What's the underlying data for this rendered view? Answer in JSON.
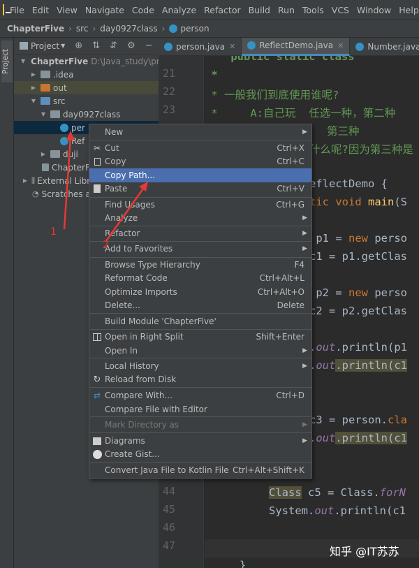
{
  "menubar": {
    "items": [
      "File",
      "Edit",
      "View",
      "Navigate",
      "Code",
      "Analyze",
      "Refactor",
      "Build",
      "Run",
      "Tools",
      "VCS",
      "Window",
      "Help"
    ]
  },
  "breadcrumb": {
    "project": "ChapterFive",
    "src": "src",
    "pkg": "day0927class",
    "cls": "person"
  },
  "sidebar": {
    "tab": "Project"
  },
  "project_panel": {
    "title": "Project"
  },
  "tree": {
    "root_label": "ChapterFive",
    "root_path": "D:\\Java_study\\prc",
    "idea": ".idea",
    "out": "out",
    "src": "src",
    "pkg": "day0927class",
    "person": "per",
    "reflect": "Ref",
    "duji": "duji",
    "iml": "ChapterF",
    "extlib": "External Libr",
    "scratch": "Scratches an"
  },
  "tabs": [
    {
      "label": "person.java"
    },
    {
      "label": "ReflectDemo.java"
    },
    {
      "label": "Number.java"
    }
  ],
  "gutter": {
    "lines": [
      "21",
      "22",
      "23",
      "",
      "",
      "",
      "",
      "",
      "",
      "",
      "",
      "",
      "",
      "",
      "",
      "",
      "",
      "",
      "",
      "",
      "",
      "",
      "",
      "",
      "44",
      "45",
      "46",
      "47"
    ]
  },
  "code": {
    "l20": "    public static class ",
    "l21": " *",
    "l22": " * 一般我们到底使用谁呢?",
    "l23a": " *     A:自己玩  任选一种，第二种",
    "l23b": "第三种",
    "l23c": "什么呢?因为第三种是",
    "l_cls": "eflectDemo {",
    "l_main_kw": "tic void ",
    "l_main_fn": "main",
    "l_main_rest": "(S",
    "l_p1": " p1 = ",
    "l_p1_new": "new",
    "l_p1_rest": " perso",
    "l_c1": "c1 = p1.getClas",
    "l_p2": " p2 = ",
    "l_p2_new": "new",
    "l_p2_rest": " perso",
    "l_c2": "c2 = p2.getClas",
    "l_pr1a": ".",
    "l_pr1b": "out",
    "l_pr1c": ".println(p1",
    "l_pr2a": ".",
    "l_pr2b": "out",
    "l_pr2c": ".println(c1",
    "l_c3": "c3 = person.",
    "l_c3b": "cla",
    "l_pr3a": ".",
    "l_pr3b": "out",
    "l_pr3c": ".println(c1",
    "l_c5a": "Class",
    "l_c5b": " c5 = Class.",
    "l_c5c": "forN",
    "l_pr4a": "System.",
    "l_pr4b": "out",
    "l_pr4c": ".println(c1",
    "l_close": "}"
  },
  "context_menu": [
    {
      "label": "New",
      "shortcut": "",
      "submenu": true
    },
    {
      "label": "Cut",
      "shortcut": "Ctrl+X",
      "icon": "scissors-icon"
    },
    {
      "label": "Copy",
      "shortcut": "Ctrl+C",
      "icon": "copy-icon"
    },
    {
      "label": "Copy Path...",
      "shortcut": "",
      "highlighted": true
    },
    {
      "label": "Paste",
      "shortcut": "Ctrl+V",
      "icon": "paste-icon"
    },
    {
      "label": "Find Usages",
      "shortcut": "Ctrl+G"
    },
    {
      "label": "Analyze",
      "shortcut": "",
      "submenu": true
    },
    {
      "label": "Refactor",
      "shortcut": "",
      "submenu": true
    },
    {
      "label": "Add to Favorites",
      "shortcut": "",
      "submenu": true
    },
    {
      "label": "Browse Type Hierarchy",
      "shortcut": "F4"
    },
    {
      "label": "Reformat Code",
      "shortcut": "Ctrl+Alt+L"
    },
    {
      "label": "Optimize Imports",
      "shortcut": "Ctrl+Alt+O"
    },
    {
      "label": "Delete...",
      "shortcut": "Delete"
    },
    {
      "label": "Build Module 'ChapterFive'",
      "shortcut": ""
    },
    {
      "label": "Open in Right Split",
      "shortcut": "Shift+Enter",
      "icon": "split-icon"
    },
    {
      "label": "Open In",
      "shortcut": "",
      "submenu": true
    },
    {
      "label": "Local History",
      "shortcut": "",
      "submenu": true
    },
    {
      "label": "Reload from Disk",
      "shortcut": "",
      "icon": "reload-icon"
    },
    {
      "label": "Compare With...",
      "shortcut": "Ctrl+D",
      "icon": "compare-icon"
    },
    {
      "label": "Compare File with Editor",
      "shortcut": ""
    },
    {
      "label": "Mark Directory as",
      "shortcut": "",
      "submenu": true,
      "disabled": true
    },
    {
      "label": "Diagrams",
      "shortcut": "",
      "submenu": true,
      "icon": "diagram-icon"
    },
    {
      "label": "Create Gist...",
      "shortcut": "",
      "icon": "github-icon"
    },
    {
      "label": "Convert Java File to Kotlin File",
      "shortcut": "Ctrl+Alt+Shift+K"
    }
  ],
  "annotations": {
    "one": "1",
    "two": "2"
  },
  "watermark": "知乎 @IT苏苏",
  "colors": {
    "accent": "#4b6eaf",
    "arrow": "#e53935",
    "background": "#2b2b2b",
    "panel": "#3c3f41"
  }
}
